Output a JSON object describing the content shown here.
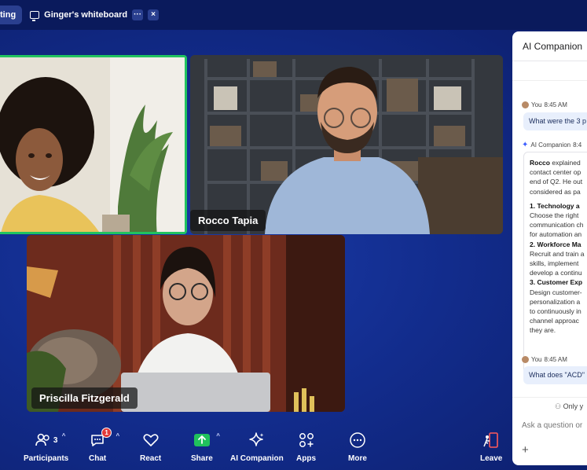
{
  "tabs": {
    "meeting_label": "ting",
    "whiteboard_label": "Ginger's whiteboard",
    "more_label": "···",
    "close_label": "×"
  },
  "videos": {
    "rocco_name": "Rocco Tapia",
    "priscilla_name": "Priscilla Fitzgerald"
  },
  "toolbar": {
    "participants_label": "Participants",
    "participants_count": "3",
    "chat_label": "Chat",
    "chat_badge": "1",
    "react_label": "React",
    "share_label": "Share",
    "ai_label": "AI Companion",
    "apps_label": "Apps",
    "more_label": "More",
    "leave_label": "Leave"
  },
  "panel": {
    "title": "AI Companion",
    "msg1_author": "You",
    "msg1_time": "8:45 AM",
    "msg1_text": "What were the 3 p",
    "ai_author": "AI Companion",
    "ai_time": "8:4",
    "ai_lines": {
      "l1a": "Rocco",
      "l1b": " explained",
      "l2": "contact center op",
      "l3": "end of Q2. He out",
      "l4": "considered as pa",
      "h1": "1. Technology a",
      "h1a": "Choose the right",
      "h1b": "communication ch",
      "h1c": "for automation an",
      "h2": "2. Workforce Ma",
      "h2a": "Recruit and train a",
      "h2b": "skills, implement",
      "h2c": "develop a continu",
      "h3": "3. Customer Exp",
      "h3a": "Design customer-",
      "h3b": "personalization a",
      "h3c": "to continuously in",
      "h3d": "channel approac",
      "h3e": "they are."
    },
    "msg2_author": "You",
    "msg2_time": "8:45 AM",
    "msg2_text": "What does \"ACD\"",
    "only_text": "Only y",
    "input_placeholder": "Ask a question or",
    "plus": "+"
  },
  "colors": {
    "background": "#122c8c",
    "active_speaker_border": "#21c35f",
    "share_green": "#20c15c",
    "badge_red": "#e23a3a"
  }
}
